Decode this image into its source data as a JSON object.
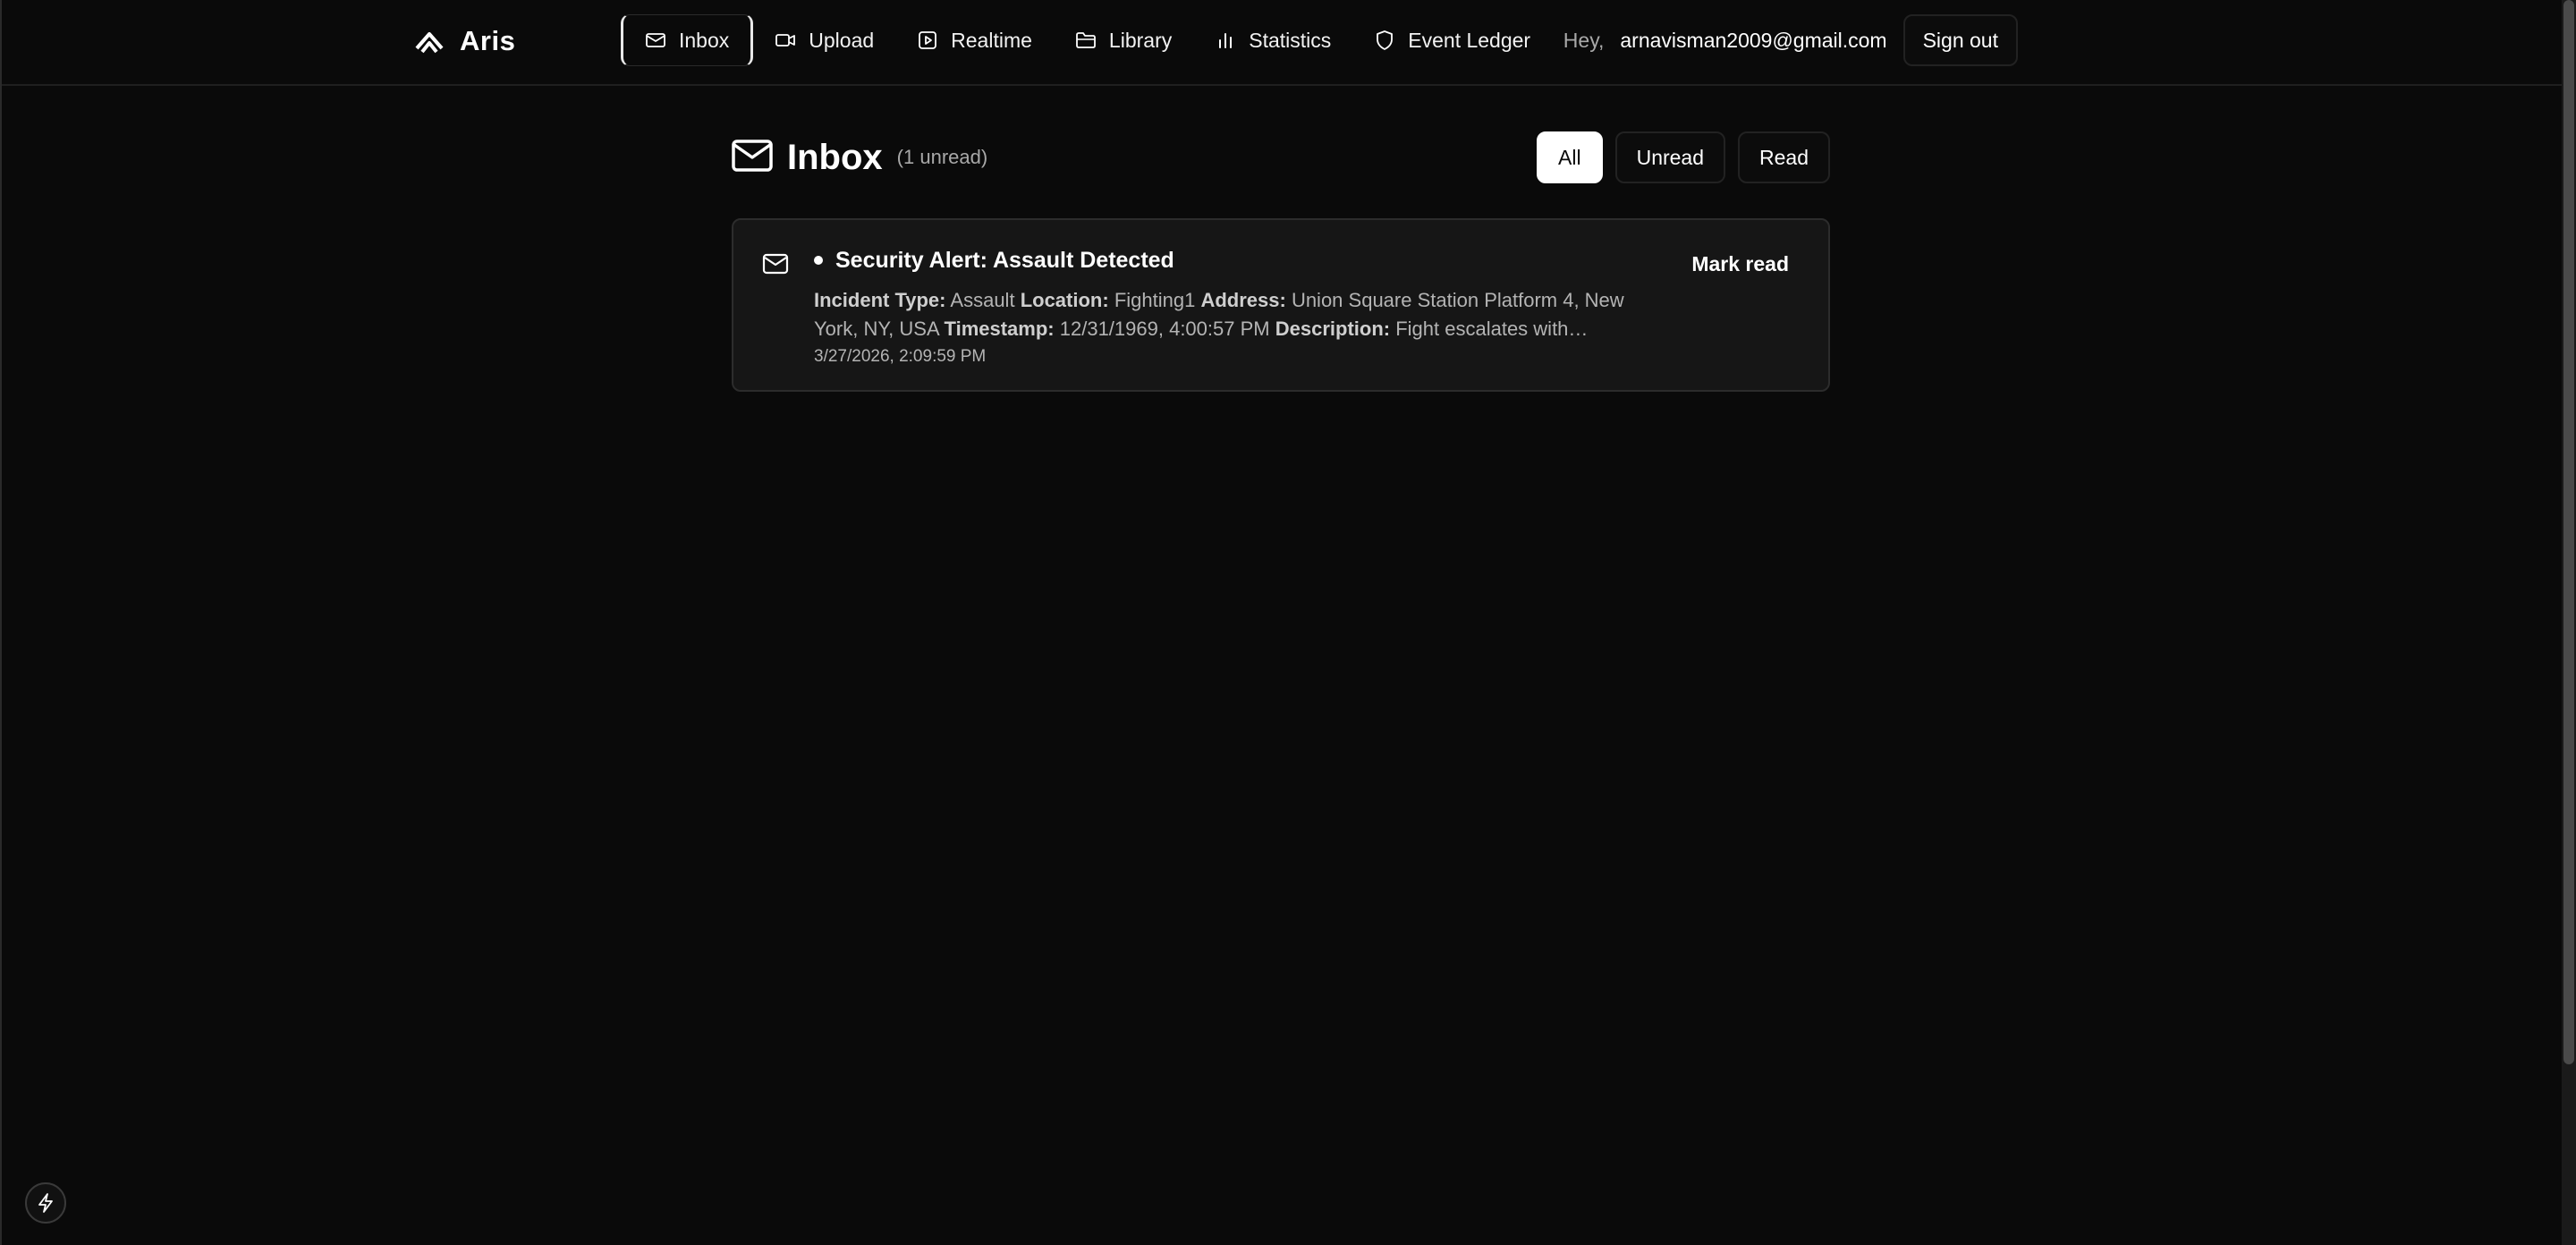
{
  "brand": {
    "name": "Aris"
  },
  "nav": {
    "items": [
      {
        "label": "Inbox",
        "icon": "mail-icon",
        "active": true
      },
      {
        "label": "Upload",
        "icon": "video-icon"
      },
      {
        "label": "Realtime",
        "icon": "play-square-icon"
      },
      {
        "label": "Library",
        "icon": "folder-icon"
      },
      {
        "label": "Statistics",
        "icon": "bar-chart-icon"
      },
      {
        "label": "Event Ledger",
        "icon": "shield-icon"
      }
    ]
  },
  "user": {
    "greeting": "Hey,",
    "email": "arnavisman2009@gmail.com",
    "signout_label": "Sign out"
  },
  "page": {
    "title": "Inbox",
    "unread_count": "(1 unread)"
  },
  "filters": [
    {
      "label": "All",
      "active": true
    },
    {
      "label": "Unread"
    },
    {
      "label": "Read"
    }
  ],
  "messages": [
    {
      "title": "Security Alert: Assault Detected",
      "unread": true,
      "fields": {
        "incident_type_label": "Incident Type:",
        "incident_type": "Assault",
        "location_label": "Location:",
        "location": "Fighting1",
        "address_label": "Address:",
        "address": "Union Square Station Platform 4, New York, NY, USA",
        "timestamp_label": "Timestamp:",
        "timestamp": "12/31/1969, 4:00:57 PM",
        "description_label": "Description:",
        "description": "Fight escalates with…"
      },
      "received": "3/27/2026, 2:09:59 PM",
      "action_label": "Mark read"
    }
  ],
  "colors": {
    "background": "#0a0a0a",
    "card": "#161616",
    "muted_text": "#a8a8a8",
    "accent": "#ffffff"
  }
}
